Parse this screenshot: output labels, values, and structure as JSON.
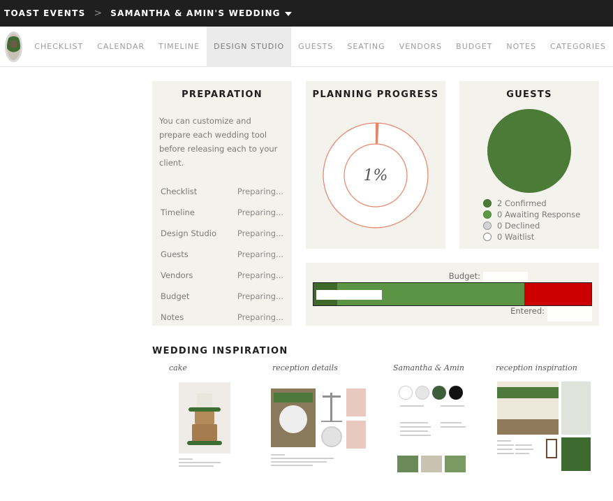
{
  "topbar": {
    "brand": "TOAST EVENTS",
    "separator": ">",
    "event_name": "SAMANTHA & AMIN'S WEDDING"
  },
  "nav": {
    "tabs": [
      {
        "label": "CHECKLIST"
      },
      {
        "label": "CALENDAR"
      },
      {
        "label": "TIMELINE"
      },
      {
        "label": "DESIGN STUDIO",
        "active": true
      },
      {
        "label": "GUESTS"
      },
      {
        "label": "SEATING"
      },
      {
        "label": "VENDORS"
      },
      {
        "label": "BUDGET"
      },
      {
        "label": "NOTES"
      },
      {
        "label": "CATEGORIES"
      }
    ]
  },
  "preparation": {
    "title": "PREPARATION",
    "intro": "You can customize and prepare each wedding tool before releasing each to your client.",
    "rows": [
      {
        "tool": "Checklist",
        "status": "Preparing..."
      },
      {
        "tool": "Timeline",
        "status": "Preparing..."
      },
      {
        "tool": "Design Studio",
        "status": "Preparing..."
      },
      {
        "tool": "Guests",
        "status": "Preparing..."
      },
      {
        "tool": "Vendors",
        "status": "Preparing..."
      },
      {
        "tool": "Budget",
        "status": "Preparing..."
      },
      {
        "tool": "Notes",
        "status": "Preparing..."
      }
    ]
  },
  "planning_progress": {
    "title": "PLANNING PROGRESS",
    "percent_label": "1%",
    "percent_value": 1,
    "accent_color": "#e9846a"
  },
  "guests": {
    "title": "GUESTS",
    "legend": [
      {
        "label": "2 Confirmed",
        "color": "#4b7b36"
      },
      {
        "label": "0 Awaiting Response",
        "color": "#5c9a45"
      },
      {
        "label": "0 Declined",
        "color": "#d4d4d4"
      },
      {
        "label": "0 Waitlist",
        "color": "#ffffff"
      }
    ]
  },
  "budget": {
    "budget_label": "Budget:",
    "entered_label": "Entered:",
    "colors": {
      "under": "#5a9444",
      "over": "#cc0000",
      "paid": "#3d6a2b"
    },
    "entered_fraction": 0.76,
    "paid_fraction": 0.085
  },
  "inspiration": {
    "title": "WEDDING INSPIRATION",
    "boards": [
      {
        "caption": "cake"
      },
      {
        "caption": "reception details"
      },
      {
        "caption": "Samantha & Amin"
      },
      {
        "caption": "reception inspiration"
      }
    ]
  }
}
